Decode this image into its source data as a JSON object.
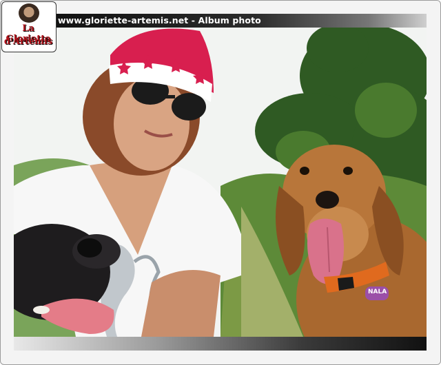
{
  "header": {
    "site_title": "www.gloriette-artemis.net - Album photo"
  },
  "logo": {
    "line1": "La Gloriette",
    "line2": "d'Artémis"
  },
  "photo": {
    "subject": "photo",
    "tag_text": "NALA",
    "colors": {
      "sky": "#f2f4f2",
      "foliage_dark": "#2f5a23",
      "foliage_light": "#6f9a3e",
      "hat_red": "#d81f4f",
      "shirt": "#f7f7f7",
      "dog_fur": "#b8763a",
      "collar": "#e06a1e"
    }
  }
}
